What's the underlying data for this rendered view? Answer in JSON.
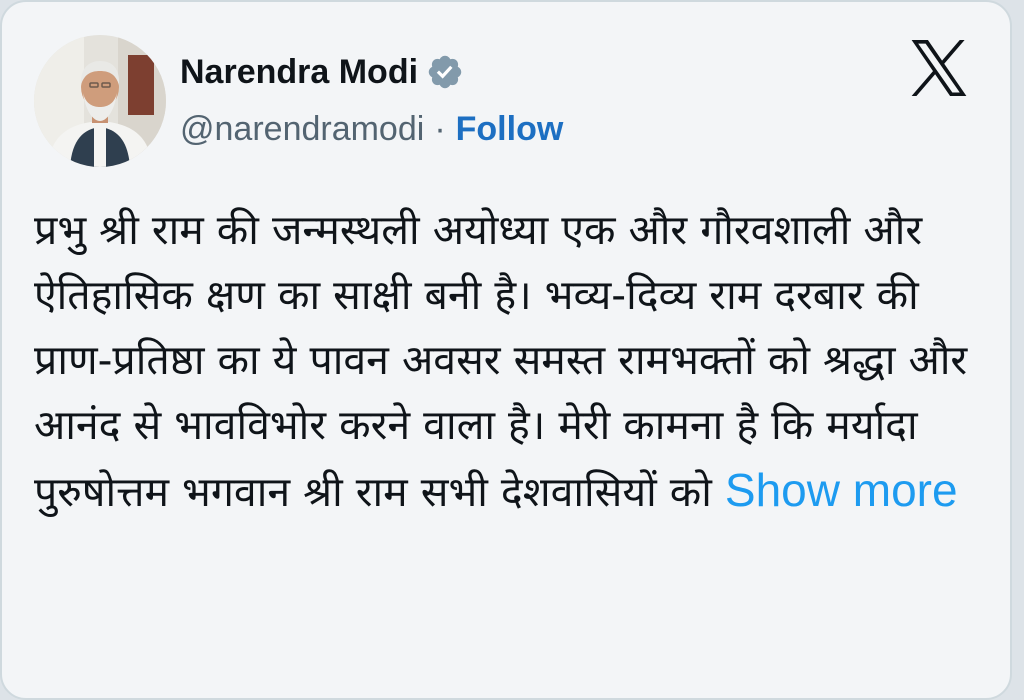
{
  "tweet": {
    "author": {
      "display_name": "Narendra Modi",
      "handle": "@narendramodi",
      "verified": true,
      "separator": "·",
      "follow_label": "Follow"
    },
    "text": "प्रभु श्री राम की जन्मस्थली अयोध्या एक और गौरवशाली और ऐतिहासिक क्षण का साक्षी बनी है। भव्य-दिव्य राम दरबार की प्राण-प्रतिष्ठा का ये पावन अवसर समस्त रामभक्तों को श्रद्धा और आनंद से भावविभोर करने वाला है। मेरी कामना है कि मर्यादा पुरुषोत्तम भगवान श्री राम सभी देशवासियों को",
    "show_more_label": "Show more"
  },
  "icons": {
    "verified": "verified-badge-icon",
    "platform": "x-logo-icon"
  },
  "colors": {
    "card_background": "#f3f5f7",
    "text_primary": "#0f1419",
    "text_secondary": "#536471",
    "follow_link": "#1d6fc2",
    "show_more_link": "#1d9bf0",
    "verified_badge": "#829aab"
  }
}
